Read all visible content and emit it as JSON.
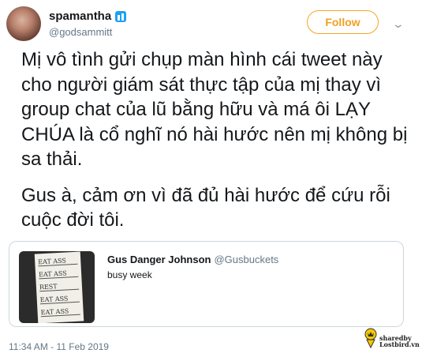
{
  "author": {
    "display_name": "spamantha",
    "handle": "@godsammitt"
  },
  "follow_label": "Follow",
  "tweet": {
    "paragraph_1": "Mị vô tình gửi chụp màn hình cái tweet này cho người giám sát thực tập của mị thay vì group chat của lũ bằng hữu và má ôi LẠY CHÚA là cổ nghĩ nó hài hước nên mị không bị sa thải.",
    "paragraph_2": "Gus à, cảm ơn vì đã đủ hài hước để cứu rỗi cuộc đời tôi."
  },
  "quoted": {
    "display_name": "Gus Danger Johnson",
    "handle": "@Gusbuckets",
    "text": "busy week",
    "image_lines": [
      "EAT ASS",
      "EAT ASS",
      "REST",
      "EAT ASS",
      "EAT ASS"
    ]
  },
  "timestamp": "11:34 AM - 11 Feb 2019",
  "watermark": {
    "line_1": "sharedby",
    "line_2": "Lostbird.vn"
  },
  "colors": {
    "follow_accent": "#f5a623",
    "secondary_text": "#657786",
    "verified_badge": "#1da1f2"
  },
  "icons": [
    "verified-badge-icon",
    "chevron-down-icon",
    "lostbird-logo-icon"
  ]
}
